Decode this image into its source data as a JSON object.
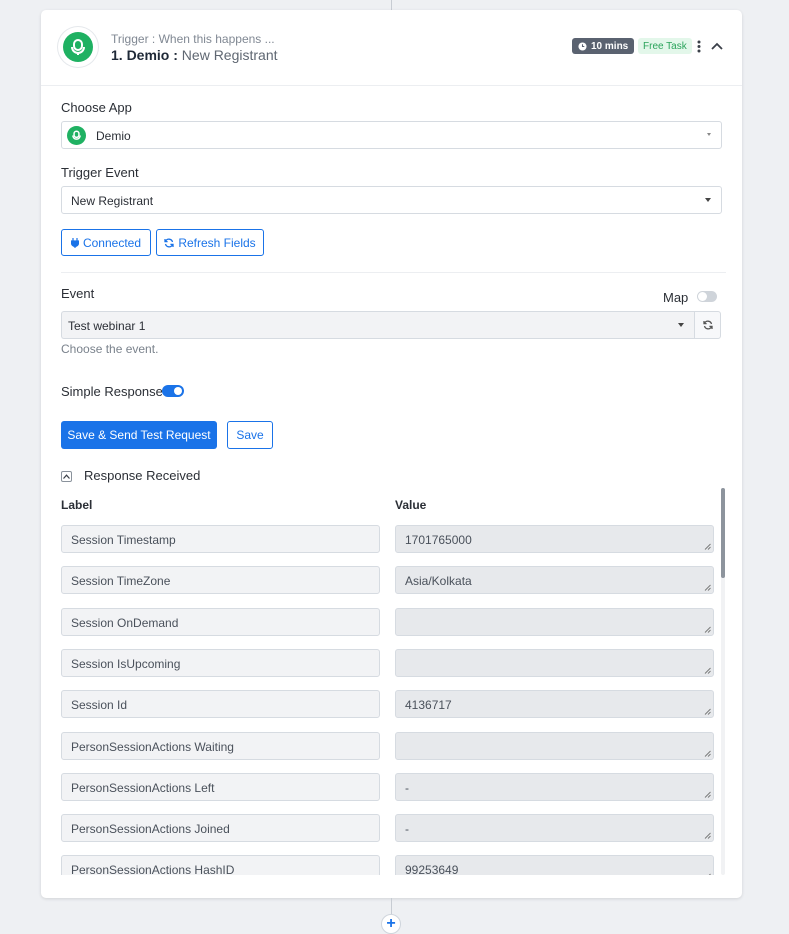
{
  "header": {
    "trigger_caption": "Trigger : When this happens ...",
    "step_number_app": "1. Demio :",
    "step_event": "New Registrant",
    "time_badge": "10 mins",
    "task_badge": "Free Task",
    "icons": [
      "demio-logo-icon",
      "clock-icon",
      "kebab-menu-icon",
      "chevron-up-icon"
    ]
  },
  "choose_app": {
    "label": "Choose App",
    "value": "Demio"
  },
  "trigger_event": {
    "label": "Trigger Event",
    "value": "New Registrant"
  },
  "buttons": {
    "connected": "Connected",
    "refresh_fields": "Refresh Fields"
  },
  "event": {
    "label": "Event",
    "map_label": "Map",
    "map_enabled": false,
    "value": "Test webinar 1",
    "hint": "Choose the event."
  },
  "simple_response": {
    "label": "Simple Response",
    "enabled": true
  },
  "actions": {
    "save_send": "Save & Send Test Request",
    "save": "Save"
  },
  "response": {
    "title": "Response Received",
    "label_header": "Label",
    "value_header": "Value",
    "rows": [
      {
        "label": "Session Timestamp",
        "value": "1701765000"
      },
      {
        "label": "Session TimeZone",
        "value": "Asia/Kolkata"
      },
      {
        "label": "Session OnDemand",
        "value": ""
      },
      {
        "label": "Session IsUpcoming",
        "value": ""
      },
      {
        "label": "Session Id",
        "value": "4136717"
      },
      {
        "label": "PersonSessionActions Waiting",
        "value": ""
      },
      {
        "label": "PersonSessionActions Left",
        "value": "-"
      },
      {
        "label": "PersonSessionActions Joined",
        "value": "-"
      },
      {
        "label": "PersonSessionActions HashID",
        "value": "99253649"
      }
    ]
  },
  "colors": {
    "accent": "#1a73e8",
    "brand_green": "#1fb162",
    "badge_dark": "#5a6270",
    "free_task": "#2aa35a"
  }
}
